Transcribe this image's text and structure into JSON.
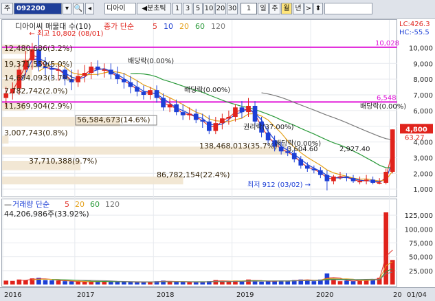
{
  "toolbar": {
    "market": "주",
    "code": "092200",
    "name": "디아이",
    "split_label": "◀분초틱",
    "period_nums": [
      "1",
      "3",
      "5",
      "10",
      "20",
      "30"
    ],
    "count_value": "1",
    "periods": [
      "일",
      "주",
      "월",
      "년"
    ],
    "selected_period": "월",
    "next": ">",
    "updown": "⬍"
  },
  "price_panel": {
    "legend_title": "디아이씨 매물대 수(10)",
    "ma_legend": {
      "label": "종가 단순",
      "periods": [
        "5",
        "10",
        "20",
        "60",
        "120"
      ],
      "colors": [
        "#e0342c",
        "#1f3fd0",
        "#e4a11b",
        "#2a9a3a",
        "#7a7a7a"
      ]
    },
    "lc_label": "LC:426.3",
    "hc_label": "HC:-55.5",
    "high_label": "최고 10,802 (08/01)",
    "low_label": "최저 912 (03/02)",
    "line1_value": "10,028",
    "line2_value": "6,548",
    "current_price": "4,800",
    "current_pct": "63.27",
    "vp_labels": [
      "12,480,686(3.2%)",
      "19,371,559(5.0%)",
      "14,694,093(3.7%)",
      "7,782,742(2.0%)",
      "11,369,904(2.9%)",
      "56,584,673(14.6%)",
      "3,007,743(0.8%)",
      "138,468,013(35.7%)",
      "37,710,388(9.7%)",
      "86,782,154(22.4%)"
    ],
    "vp_pct": [
      3.2,
      5.0,
      3.7,
      2.0,
      2.9,
      14.6,
      0.8,
      35.7,
      9.7,
      22.4
    ],
    "annotations": [
      "배당락(0.00%)",
      "배당락(0.00%)",
      "권리락(37.00%)",
      "배당락(0.00%)",
      "배당락(0.00%)",
      "3,604.60",
      "2,927.40"
    ],
    "y_ticks": [
      "10,000",
      "9,000",
      "8,000",
      "7,000",
      "6,000",
      "5,000",
      "4,000",
      "3,000",
      "2,000",
      "1,000"
    ]
  },
  "volume_panel": {
    "legend": "거래량 단순",
    "ma_periods": [
      "5",
      "20",
      "60",
      "120"
    ],
    "ma_colors": [
      "#e0342c",
      "#e4a11b",
      "#2a9a3a",
      "#7a7a7a"
    ],
    "summary": "44,206,986주(33.92%)",
    "current_volume": "44,207",
    "current_pct": "33.92%",
    "y_ticks": [
      "125,000",
      "100,000",
      "75,000",
      "50,000",
      "25,000"
    ]
  },
  "x_axis": {
    "labels": [
      "2016",
      "2017",
      "2018",
      "2019",
      "2020",
      "20"
    ],
    "date_label": "01/04"
  },
  "chart_data": {
    "type": "candlestick",
    "interval": "monthly",
    "x": [
      "2016-02",
      "2016-03",
      "2016-04",
      "2016-05",
      "2016-06",
      "2016-07",
      "2016-08",
      "2016-09",
      "2016-10",
      "2016-11",
      "2016-12",
      "2017-01",
      "2017-02",
      "2017-03",
      "2017-04",
      "2017-05",
      "2017-06",
      "2017-07",
      "2017-08",
      "2017-09",
      "2017-10",
      "2017-11",
      "2017-12",
      "2018-01",
      "2018-02",
      "2018-03",
      "2018-04",
      "2018-05",
      "2018-06",
      "2018-07",
      "2018-08",
      "2018-09",
      "2018-10",
      "2018-11",
      "2018-12",
      "2019-01",
      "2019-02",
      "2019-03",
      "2019-04",
      "2019-05",
      "2019-06",
      "2019-07",
      "2019-08",
      "2019-09",
      "2019-10",
      "2019-11",
      "2019-12",
      "2020-01",
      "2020-02",
      "2020-03",
      "2020-04",
      "2020-05",
      "2020-06",
      "2020-07",
      "2020-08",
      "2020-09",
      "2020-10",
      "2020-11",
      "2020-12",
      "2021-01"
    ],
    "open": [
      6800,
      7100,
      7400,
      8600,
      9200,
      9900,
      8800,
      8700,
      8600,
      8600,
      8000,
      7800,
      8200,
      8400,
      8800,
      8600,
      8600,
      8300,
      8000,
      7800,
      7500,
      7200,
      7000,
      7300,
      6800,
      6200,
      6400,
      5900,
      5700,
      5800,
      5400,
      5300,
      4700,
      5200,
      5500,
      5600,
      6200,
      5900,
      6300,
      5300,
      4600,
      4100,
      3700,
      3400,
      3300,
      2900,
      2500,
      2300,
      2200,
      1900,
      1500,
      1800,
      1800,
      1700,
      1500,
      1500,
      1600,
      1400,
      1400,
      2100
    ],
    "high": [
      7500,
      7800,
      9000,
      9800,
      10300,
      10802,
      9400,
      9100,
      9000,
      8800,
      8600,
      8600,
      8900,
      9100,
      9200,
      9000,
      9000,
      8800,
      8400,
      8200,
      7900,
      7600,
      7500,
      7600,
      7100,
      6800,
      6700,
      6400,
      6200,
      6100,
      5800,
      5700,
      5600,
      5800,
      6000,
      6400,
      6600,
      6800,
      6600,
      5600,
      5000,
      4400,
      4000,
      3700,
      3500,
      3100,
      2700,
      2500,
      2400,
      2200,
      1900,
      2100,
      2000,
      1900,
      1800,
      1900,
      1800,
      1700,
      2300,
      4800
    ],
    "low": [
      6200,
      6700,
      7000,
      8200,
      8600,
      8500,
      8200,
      8000,
      7900,
      7600,
      7300,
      7500,
      7800,
      8000,
      8200,
      8100,
      8000,
      7700,
      7400,
      7100,
      6900,
      6700,
      6700,
      6500,
      6000,
      5900,
      5700,
      5400,
      5400,
      5200,
      4900,
      4500,
      4500,
      4800,
      5100,
      5300,
      5500,
      5600,
      5000,
      4300,
      3800,
      3400,
      3200,
      3100,
      2700,
      2300,
      2100,
      2000,
      1700,
      912,
      1300,
      1600,
      1500,
      1400,
      1300,
      1300,
      1300,
      1300,
      1300,
      2000
    ],
    "close": [
      7100,
      7400,
      8600,
      9200,
      9900,
      8800,
      8700,
      8600,
      8600,
      8000,
      7800,
      8200,
      8400,
      8800,
      8600,
      8600,
      8300,
      8000,
      7800,
      7500,
      7200,
      7000,
      7300,
      6800,
      6200,
      6400,
      5900,
      5700,
      5800,
      5400,
      5300,
      4700,
      5200,
      5500,
      5600,
      6200,
      5900,
      6300,
      5300,
      4600,
      4100,
      3700,
      3400,
      3300,
      2900,
      2500,
      2300,
      2200,
      1900,
      1500,
      1800,
      1800,
      1700,
      1500,
      1500,
      1600,
      1400,
      1400,
      2100,
      4800
    ],
    "volume": [
      7000,
      6500,
      9000,
      8000,
      11000,
      12000,
      8000,
      7500,
      7000,
      6000,
      5500,
      5000,
      4500,
      5000,
      6000,
      5500,
      5000,
      5500,
      4500,
      4500,
      4000,
      4000,
      5000,
      6000,
      7000,
      5000,
      4500,
      5000,
      4000,
      4000,
      5000,
      6000,
      8000,
      6000,
      5000,
      7000,
      6000,
      9000,
      7000,
      5000,
      6000,
      6000,
      7000,
      6500,
      8000,
      9000,
      8500,
      6000,
      9000,
      20000,
      9000,
      6000,
      7000,
      6000,
      8000,
      9000,
      10000,
      12000,
      130000,
      44207
    ],
    "ylim": [
      700,
      11200
    ],
    "vol_ylim": [
      0,
      135000
    ],
    "ma_series": [
      {
        "name": "5"
      },
      {
        "name": "10"
      },
      {
        "name": "20"
      },
      {
        "name": "60"
      },
      {
        "name": "120"
      }
    ]
  }
}
